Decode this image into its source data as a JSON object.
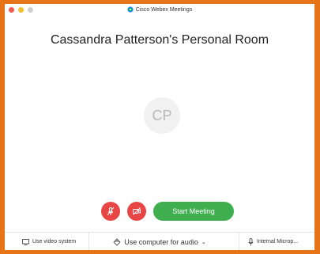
{
  "window": {
    "app_title": "Cisco Webex Meetings",
    "room_title": "Cassandra Patterson's Personal Room"
  },
  "avatar": {
    "initials": "CP"
  },
  "controls": {
    "start_meeting_label": "Start Meeting",
    "mute_icon": "muted-microphone-icon",
    "video_icon": "video-off-icon",
    "accent_red": "#e84545",
    "accent_green": "#3fae4f"
  },
  "footer": {
    "video_system_label": "Use video system",
    "audio_label": "Use computer for audio",
    "mic_label": "Internal Microp..."
  },
  "colors": {
    "frame_orange": "#e8741a"
  }
}
